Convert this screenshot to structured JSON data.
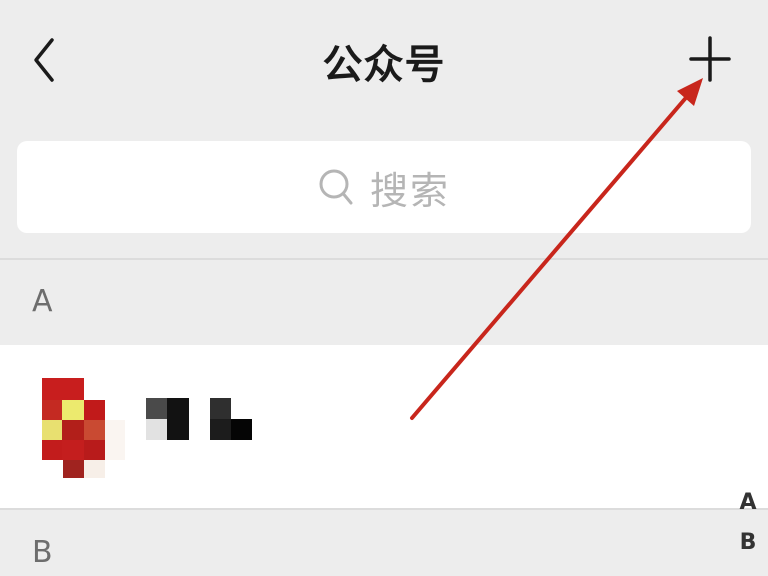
{
  "header": {
    "title": "公众号",
    "back_icon": "chevron-left-icon",
    "add_icon": "plus-icon"
  },
  "search": {
    "placeholder": "搜索",
    "icon": "search-icon"
  },
  "sections": [
    {
      "letter": "A"
    },
    {
      "letter": "B"
    }
  ],
  "index_bar": {
    "letters": [
      "A",
      "B"
    ]
  },
  "colors": {
    "background": "#ededed",
    "card": "#ffffff",
    "annotation_arrow": "#c8261c",
    "title_text": "#1a1a1a",
    "placeholder_text": "#b5b5b5"
  }
}
